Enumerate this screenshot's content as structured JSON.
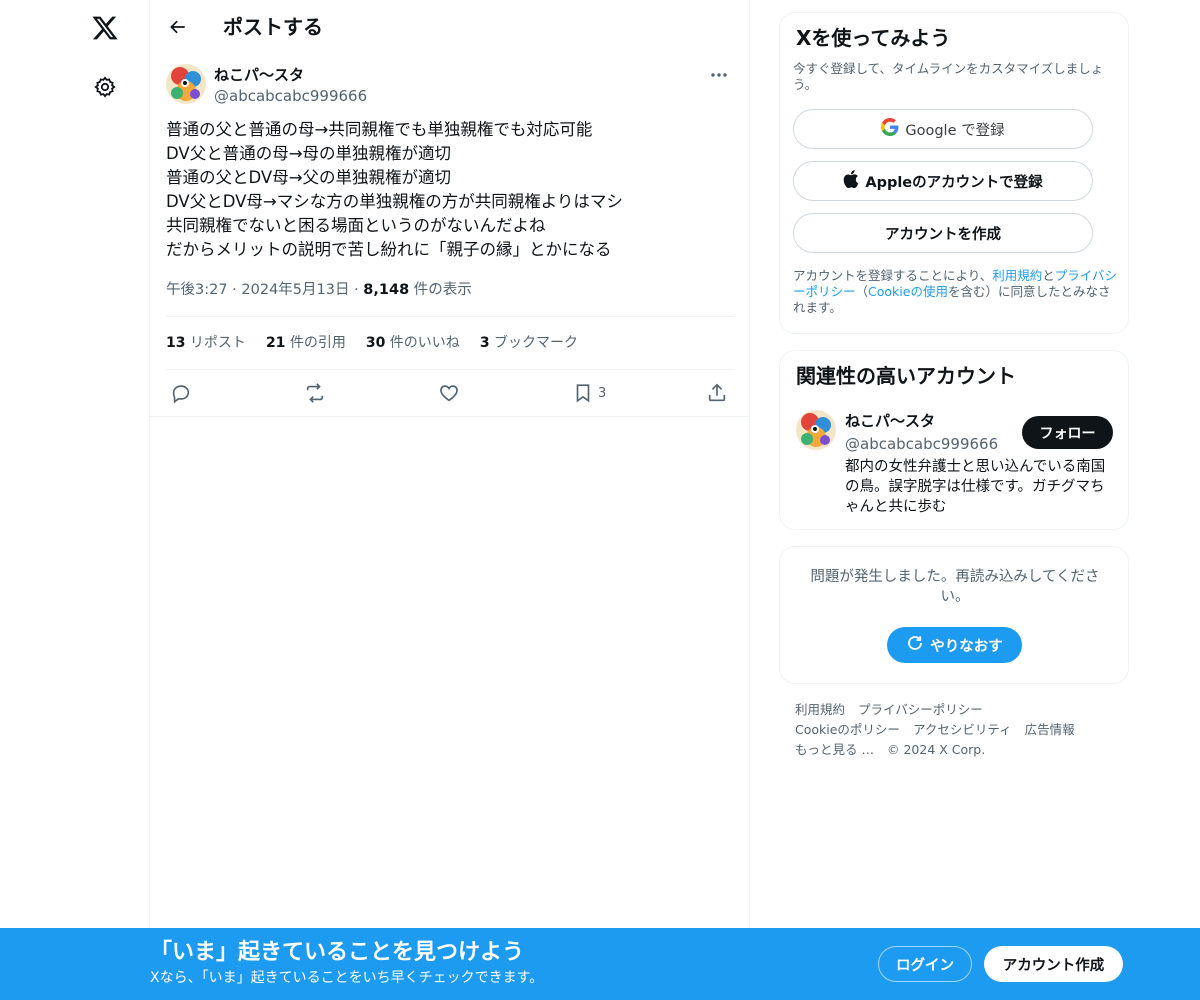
{
  "nav": {
    "logo_icon": "x-logo-icon",
    "settings_icon": "gear-icon"
  },
  "header": {
    "back_icon": "arrow-left-icon",
    "title": "ポストする"
  },
  "post": {
    "author_name": "ねこパ〜スタ",
    "author_handle": "@abcabcabc999666",
    "more_icon": "more-horizontal-icon",
    "lines": [
      "普通の父と普通の母→共同親権でも単独親権でも対応可能",
      "DV父と普通の母→母の単独親権が適切",
      "普通の父とDV母→父の単独親権が適切",
      "DV父とDV母→マシな方の単独親権の方が共同親権よりはマシ",
      "共同親権でないと困る場面というのがないんだよね",
      "だからメリットの説明で苦し紛れに「親子の縁」とかになる"
    ],
    "time": "午後3:27",
    "date": "2024年5月13日",
    "separator": "·",
    "views_count": "8,148",
    "views_label": " 件の表示",
    "stats": {
      "reposts_num": "13",
      "reposts_label": " リポスト",
      "quotes_num": "21",
      "quotes_label": " 件の引用",
      "likes_num": "30",
      "likes_label": " 件のいいね",
      "bookmarks_num": "3",
      "bookmarks_label": " ブックマーク"
    },
    "actions": {
      "reply_icon": "reply-icon",
      "repost_icon": "repost-icon",
      "like_icon": "heart-icon",
      "bookmark_icon": "bookmark-icon",
      "bookmark_count": "3",
      "share_icon": "share-icon"
    }
  },
  "signup_card": {
    "title": "Xを使ってみよう",
    "subtitle": "今すぐ登録して、タイムラインをカスタマイズしましょう。",
    "google_label": "Google で登録",
    "apple_label": "Appleのアカウントで登録",
    "create_label": "アカウントを作成",
    "legal_prefix": "アカウントを登録することにより、",
    "legal_terms": "利用規約",
    "legal_and": "と",
    "legal_privacy": "プライバシーポリシー",
    "legal_paren_open": "（",
    "legal_cookie": "Cookieの使用",
    "legal_suffix": "を含む）に同意したとみなされます。"
  },
  "related_card": {
    "title": "関連性の高いアカウント",
    "name": "ねこパ〜スタ",
    "handle": "@abcabcabc999666",
    "follow_label": "フォロー",
    "bio": "都内の女性弁護士と思い込んでいる南国の鳥。誤字脱字は仕様です。ガチグマちゃんと共に歩む"
  },
  "error_card": {
    "message": "問題が発生しました。再読み込みしてください。",
    "retry_label": "やりなおす",
    "retry_icon": "refresh-icon"
  },
  "footer": {
    "terms": "利用規約",
    "privacy": "プライバシーポリシー",
    "cookie": "Cookieのポリシー",
    "accessibility": "アクセシビリティ",
    "ads": "広告情報",
    "more": "もっと見る …",
    "copyright": "© 2024 X Corp."
  },
  "banner": {
    "title": "「いま」起きていることを見つけよう",
    "subtitle": "Xなら、「いま」起きていることをいち早くチェックできます。",
    "login_label": "ログイン",
    "signup_label": "アカウント作成"
  },
  "colors": {
    "accent": "#1d9bf0",
    "text": "#0f1419",
    "muted": "#536471",
    "border": "#eff3f4"
  }
}
